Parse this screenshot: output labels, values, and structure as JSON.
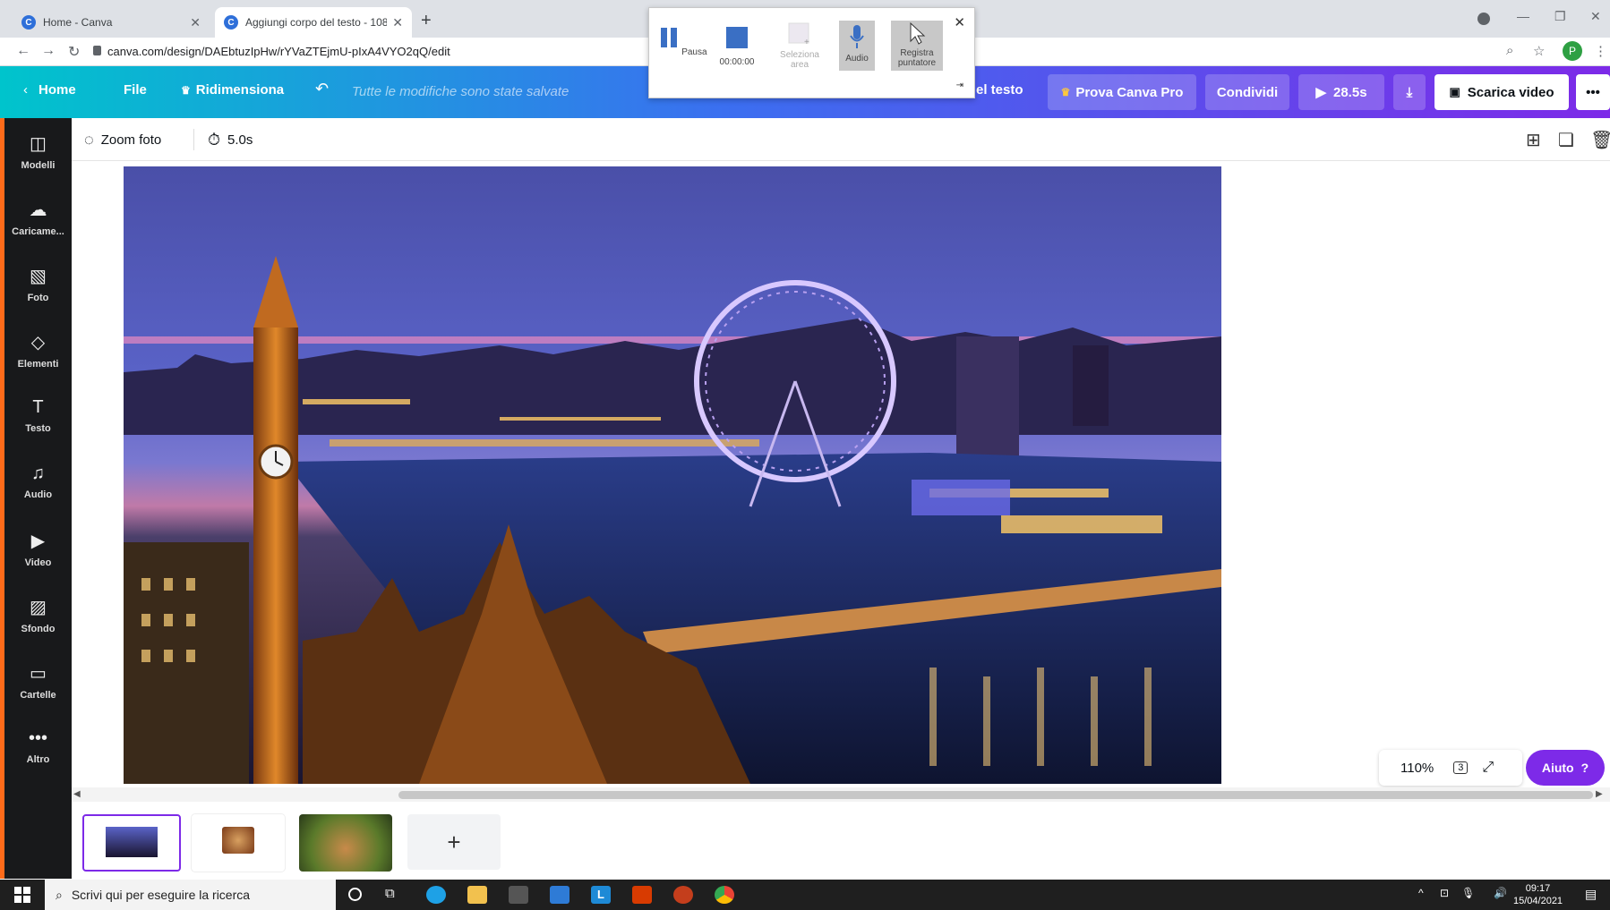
{
  "browser": {
    "tabs": [
      {
        "title": "Home - Canva"
      },
      {
        "title": "Aggiungi corpo del testo - 1080..."
      }
    ],
    "url": "canva.com/design/DAEbtuzIpHw/rYVaZTEjmU-pIxA4VYO2qQ/edit",
    "profile_initial": "P"
  },
  "header": {
    "home": "Home",
    "file": "File",
    "resize": "Ridimensiona",
    "save_status": "Tutte le modifiche sono state salvate",
    "doc_title_tail": "el testo",
    "try_pro": "Prova Canva Pro",
    "share": "Condividi",
    "play_duration": "28.5s",
    "download_video": "Scarica video"
  },
  "recorder": {
    "pause": "Pausa",
    "time": "00:00:00",
    "select_area": "Seleziona area",
    "audio": "Audio",
    "record_pointer": "Registra puntatore"
  },
  "sidebar": {
    "items": [
      {
        "label": "Modelli",
        "icon": "templates-icon"
      },
      {
        "label": "Caricame...",
        "icon": "upload-icon"
      },
      {
        "label": "Foto",
        "icon": "photo-icon"
      },
      {
        "label": "Elementi",
        "icon": "elements-icon"
      },
      {
        "label": "Testo",
        "icon": "text-icon"
      },
      {
        "label": "Audio",
        "icon": "audio-icon"
      },
      {
        "label": "Video",
        "icon": "video-icon"
      },
      {
        "label": "Sfondo",
        "icon": "background-icon"
      },
      {
        "label": "Cartelle",
        "icon": "folder-icon"
      },
      {
        "label": "Altro",
        "icon": "more-icon"
      }
    ]
  },
  "toolbar": {
    "zoom_photo": "Zoom foto",
    "duration": "5.0s"
  },
  "canvas": {
    "zoom": "110%",
    "page_count": "3",
    "help": "Aiuto"
  },
  "taskbar": {
    "search_placeholder": "Scrivi qui per eseguire la ricerca",
    "time": "09:17",
    "date": "15/04/2021"
  },
  "colors": {
    "accent": "#7d2ae8",
    "header_start": "#00c4cc",
    "sidebar": "#18191b"
  }
}
